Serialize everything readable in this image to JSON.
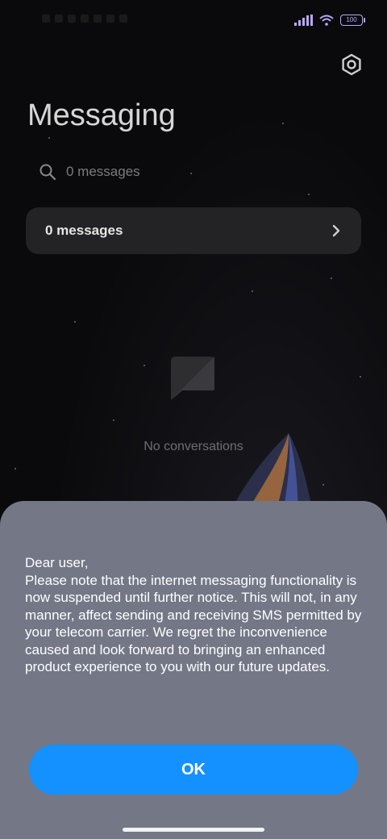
{
  "status_bar": {
    "battery": "100"
  },
  "header": {
    "title": "Messaging",
    "settings_icon": "gear-icon"
  },
  "search": {
    "placeholder": "0 messages",
    "icon": "search-icon"
  },
  "card": {
    "label": "0 messages",
    "chevron_icon": "chevron-right-icon"
  },
  "empty_state": {
    "icon": "message-bubble-icon",
    "text": "No conversations"
  },
  "dialog": {
    "message": "Dear user,\nPlease note that the internet messaging functionality is now suspended until further notice. This will not, in any manner, affect sending and receiving SMS permitted by your telecom carrier. We regret the inconvenience caused and look forward to bringing an enhanced product experience to you with our future updates.",
    "ok_label": "OK"
  },
  "colors": {
    "dialog_bg": "#747786",
    "accent": "#1490ff",
    "status_accent": "#b9a6ff"
  }
}
